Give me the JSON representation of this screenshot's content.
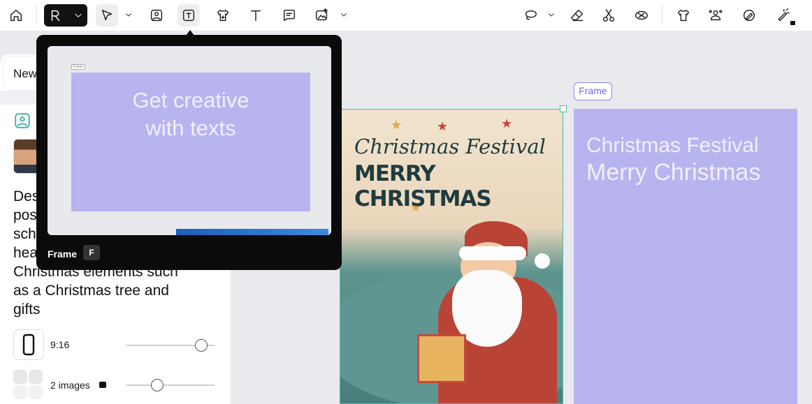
{
  "toolbar": {
    "tools": [
      {
        "name": "home-icon"
      },
      {
        "name": "logo-icon"
      },
      {
        "name": "select-arrow-icon"
      },
      {
        "name": "image-icon"
      },
      {
        "name": "frame-text-icon"
      },
      {
        "name": "tshirt-add-icon"
      },
      {
        "name": "text-icon"
      },
      {
        "name": "comment-icon"
      },
      {
        "name": "upload-image-icon"
      },
      {
        "name": "lasso-icon"
      },
      {
        "name": "eraser-icon"
      },
      {
        "name": "scissors-icon"
      },
      {
        "name": "mask-icon"
      },
      {
        "name": "tshirt-icon"
      },
      {
        "name": "group-icon"
      },
      {
        "name": "edit-circle-icon"
      },
      {
        "name": "magic-pen-icon"
      }
    ]
  },
  "panel": {
    "tab_label": "New",
    "prompt_lines": [
      "Des",
      "pos",
      "sch",
      "hea",
      "Christmas elements such",
      "as a Christmas tree and",
      "gifts"
    ],
    "ratio_label": "9:16",
    "ratio_value": 0.85,
    "images_label": "2 images",
    "images_value": 0.35
  },
  "tooltip": {
    "preview_frame_text": "Get creative\nwith texts",
    "preview_tag": "Frame",
    "label": "Frame",
    "shortcut": "F"
  },
  "canvas": {
    "poster_title_1": "Christmas Festival",
    "poster_title_2": "MERRY CHRISTMAS",
    "frame_tag": "Frame",
    "frame_text_1": "Christmas Festival",
    "frame_text_2": "Merry Christmas"
  },
  "colors": {
    "frame_fill": "#b8b4ef",
    "accent": "#6f6ad8",
    "selection": "#4dbba6"
  }
}
